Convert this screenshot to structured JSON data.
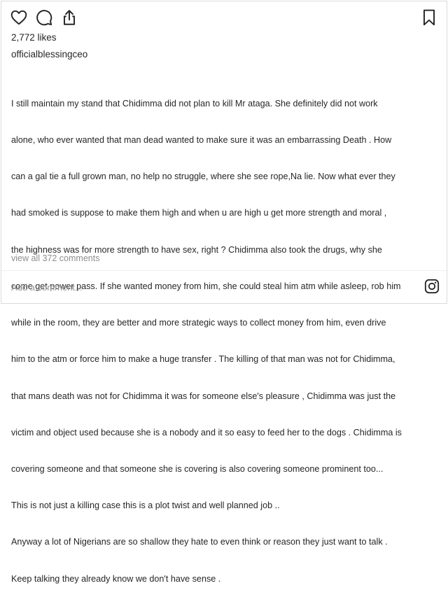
{
  "post": {
    "likes": "2,772 likes",
    "username": "officialblessingceo",
    "caption_lines": [
      "I still maintain my stand that Chidimma did not plan to kill Mr ataga. She definitely did not work",
      "alone, who ever wanted that man dead wanted to make sure it was an embarrassing Death . How",
      "can a gal tie a full grown man, no help no struggle, where she see rope,Na lie. Now what ever they",
      "had smoked is suppose to make them high and when u are high u get more strength and moral ,",
      "the highness was for more strength to have sex, right ? Chidimma also took the drugs, why she",
      "come get power pass. If she wanted money from him, she could steal him atm while asleep, rob him",
      "while in the room, they are better and more strategic ways to collect money from him, even drive",
      "him to the atm or force him to make a huge transfer . The killing of that man was not for Chidimma,",
      "that mans death was not for Chidimma it was for someone else's pleasure , Chidimma was just the",
      "victim and object used because she is a nobody and it so easy to feed her to the dogs . Chidimma is",
      "covering someone and that someone she is covering is also covering someone prominent too...",
      "This is not just a killing case this is a plot twist and well planned job ..",
      "Anyway a lot of Nigerians are so shallow they hate to even think or reason they just want to talk .",
      "Keep talking they already know we don't have sense ."
    ],
    "view_all_comments": "view all 372 comments",
    "comment_placeholder": "Add a comment...",
    "icons": {
      "like": "heart-icon",
      "comment": "comment-icon",
      "share": "share-icon",
      "save": "bookmark-icon",
      "brand": "instagram-icon"
    }
  }
}
